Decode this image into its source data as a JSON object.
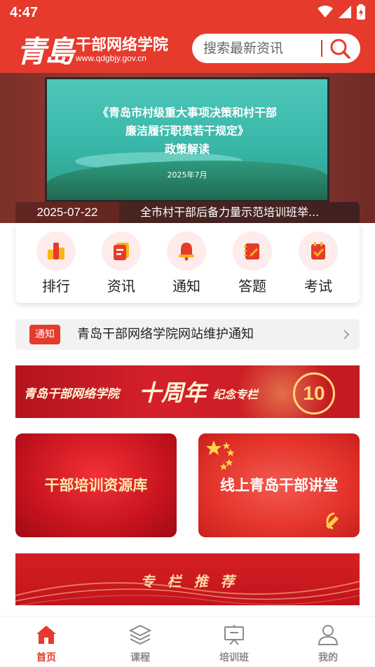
{
  "status_bar": {
    "time": "4:47"
  },
  "header": {
    "logo_calligraphy": "青島",
    "site_name": "干部网络学院",
    "site_url": "www.qdgbjy.gov.cn",
    "search_placeholder": "搜索最新资讯",
    "brand_color": "#e63a2c"
  },
  "banner": {
    "screen_line1": "《青岛市村级重大事项决策和村干部",
    "screen_line2": "廉洁履行职责若干规定》",
    "screen_line3": "政策解读",
    "screen_date": "2025年7月",
    "date": "2025-07-22",
    "title": "全市村干部后备力量示范培训班举..."
  },
  "quick_menu": [
    {
      "label": "排行",
      "icon": "ranking-icon"
    },
    {
      "label": "资讯",
      "icon": "news-icon"
    },
    {
      "label": "通知",
      "icon": "bell-icon"
    },
    {
      "label": "答题",
      "icon": "quiz-icon"
    },
    {
      "label": "考试",
      "icon": "exam-icon"
    }
  ],
  "notice": {
    "badge": "通知",
    "text": "青岛干部网络学院网站维护通知"
  },
  "anniversary": {
    "left_text": "青岛干部网络学院",
    "big_text": "十周年",
    "small_text": "纪念专栏",
    "number": "10"
  },
  "cards": {
    "resource_library": "干部培训资源库",
    "lecture_hall": "线上青岛干部讲堂"
  },
  "recommend": {
    "text": "专栏推荐"
  },
  "bottom_nav": [
    {
      "label": "首页",
      "icon": "home-icon",
      "active": true
    },
    {
      "label": "课程",
      "icon": "layers-icon",
      "active": false
    },
    {
      "label": "培训班",
      "icon": "training-icon",
      "active": false
    },
    {
      "label": "我的",
      "icon": "user-icon",
      "active": false
    }
  ]
}
